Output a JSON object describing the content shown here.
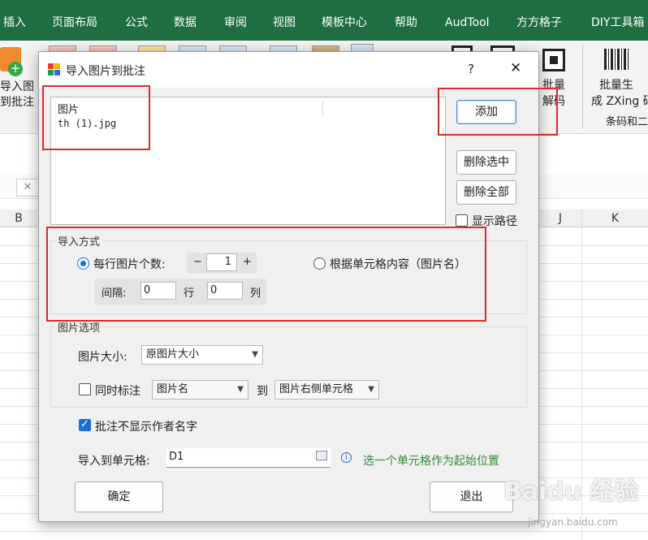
{
  "ribbon": {
    "tabs": [
      "插入",
      "页面布局",
      "公式",
      "数据",
      "审阅",
      "视图",
      "模板中心",
      "帮助",
      "AudTool",
      "方方格子",
      "DIY工具箱"
    ],
    "left_button_lines": [
      "导入图",
      "到批注"
    ],
    "batch_decode_lines": [
      "批量",
      "解码"
    ],
    "batch_gen_lines": [
      "批量生",
      "成 ZXing 码"
    ],
    "group_label": "条码和二"
  },
  "sheet": {
    "columns": [
      "B",
      "J",
      "K"
    ]
  },
  "dialog": {
    "title": "导入图片到批注",
    "help_label": "?",
    "close_label": "✕",
    "file_list": {
      "header": "图片",
      "items": [
        "th (1).jpg"
      ]
    },
    "add_button": "添加",
    "delete_selected_button": "删除选中",
    "delete_all_button": "删除全部",
    "show_path_label": "显示路径",
    "import_mode": {
      "title": "导入方式",
      "per_row_label": "每行图片个数:",
      "per_row_value": "1",
      "minus": "−",
      "plus": "+",
      "by_cell_label": "根据单元格内容（图片名）",
      "interval_label": "间隔:",
      "row_gap": "0",
      "row_unit": "行",
      "col_gap": "0",
      "col_unit": "列"
    },
    "image_options": {
      "title": "图片选项",
      "size_label": "图片大小:",
      "size_value": "原图片大小",
      "also_mark_label": "同时标注",
      "mark_value": "图片名",
      "to_label": "到",
      "target_value": "图片右侧单元格"
    },
    "hide_author_label": "批注不显示作者名字",
    "import_to_label": "导入到单元格:",
    "import_to_value": "D1",
    "hint": "选一个单元格作为起始位置",
    "ok_button": "确定",
    "exit_button": "退出"
  },
  "watermark": {
    "text": "Baidu 经验",
    "url": "jingyan.baidu.com"
  },
  "colors": {
    "ribbon_green": "#1e6e42",
    "accent_blue": "#1a6fd6",
    "hint_green": "#2f8a3a",
    "highlight_red": "#e5262b"
  }
}
